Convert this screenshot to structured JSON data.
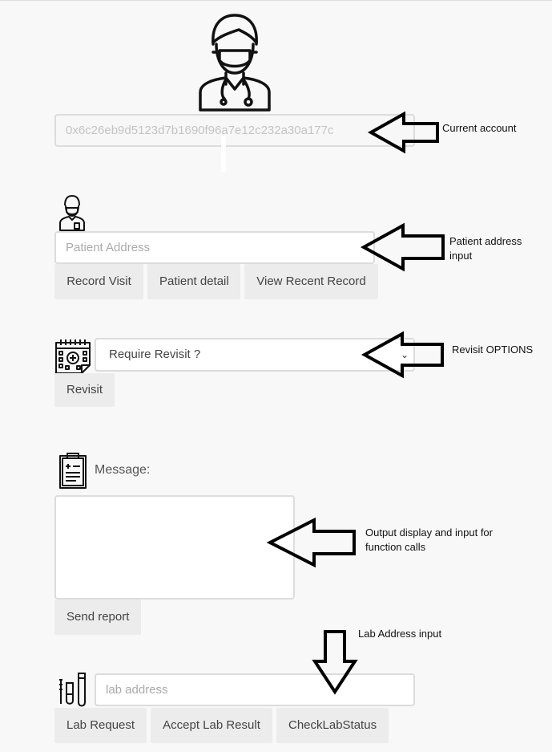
{
  "account": {
    "address": "0x6c26eb9d5123d7b1690f96a7e12c232a30a177c"
  },
  "patient": {
    "placeholder": "Patient Address",
    "buttons": {
      "record_visit": "Record Visit",
      "patient_detail": "Patient detail",
      "view_recent": "View Recent Record"
    }
  },
  "revisit": {
    "selected": "Require Revisit ?",
    "button": "Revisit"
  },
  "message": {
    "label": "Message:",
    "value": "",
    "send_button": "Send report"
  },
  "lab": {
    "placeholder": "lab address",
    "buttons": {
      "lab_request": "Lab Request",
      "accept_result": "Accept Lab Result",
      "check_status": "CheckLabStatus"
    }
  },
  "annotations": {
    "current_account": "Current account",
    "patient_input": "Patient address input",
    "revisit_options": "Revisit OPTIONS",
    "output_display": "Output display and input for function calls",
    "lab_input": "Lab Address input"
  }
}
